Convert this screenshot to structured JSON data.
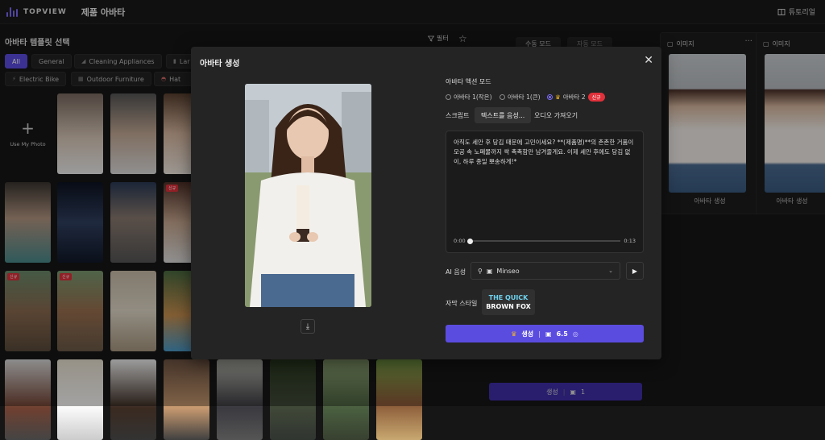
{
  "app": {
    "brand": "TOPVIEW",
    "page_title": "제품 아바타",
    "tutorial": "튜토리얼"
  },
  "left": {
    "section_title": "아바타 템플릿 선택",
    "filter_label": "필터",
    "chips_row1": [
      "All",
      "General",
      "Cleaning Appliances",
      "Lar"
    ],
    "chips_row2": [
      "Electric Bike",
      "Outdoor Furniture",
      "Hat"
    ],
    "upload_label": "Use My Photo",
    "new_badge": "신규"
  },
  "mode_tabs": [
    "수동 모드",
    "자동 모드"
  ],
  "bottom_generate": {
    "label": "생성",
    "credits": "1"
  },
  "right_panels": [
    {
      "header": "이미지",
      "caption": "아바타 생성"
    },
    {
      "header": "이미지",
      "caption": "아바타 생성"
    }
  ],
  "modal": {
    "title": "아바타 생성",
    "action_mode_label": "아바타 액션 모드",
    "radio_options": [
      "아바타 1(작은)",
      "아바타 1(큰)",
      "아바타 2"
    ],
    "new_pill": "신규",
    "script_label": "스크립트",
    "tab_tts": "텍스트를 음성...",
    "tab_audio": "오디오 가져오기",
    "script_text": "아직도 세안 후 당김 때문에 고민이세요? **(제품명)**의 촌촌한 거품이 모공 속 노폐물까지 싹 촉촉함만 남겨줄게요. 이제 세안 후에도 당김 없이, 하루 종일 뽀송하게!*",
    "time_start": "0:00",
    "time_end": "0:13",
    "voice_label": "AI 음성",
    "voice_value": "Minseo",
    "subtitle_label": "자막 스타일",
    "subtitle_line1": "THE QUICK",
    "subtitle_line2": "BROWN FOX",
    "generate_label": "생성",
    "generate_credits": "6.5"
  },
  "colors": {
    "accent": "#5b4ce0",
    "new_badge": "#e0313b",
    "bg": "#161616"
  }
}
